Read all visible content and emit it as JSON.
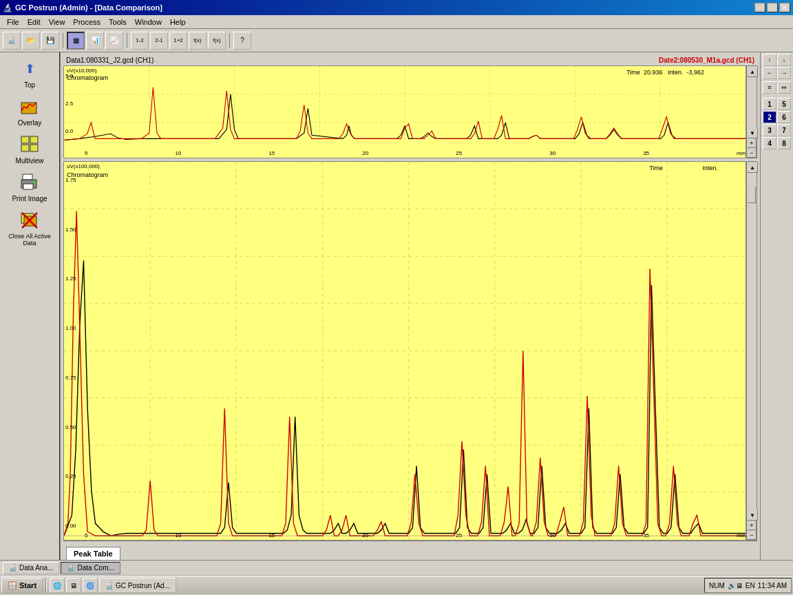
{
  "window": {
    "title": "GC Postrun (Admin) - [Data Comparison]",
    "app_icon": "🔬"
  },
  "title_controls": {
    "minimize": "─",
    "maximize": "□",
    "close": "✕",
    "inner_minimize": "─",
    "inner_maximize": "□",
    "inner_close": "✕"
  },
  "menu": {
    "items": [
      "File",
      "Edit",
      "View",
      "Process",
      "Tools",
      "Window",
      "Help"
    ]
  },
  "sidebar": {
    "items": [
      {
        "id": "top",
        "label": "Top",
        "icon": "⬆"
      },
      {
        "id": "overlay",
        "label": "Overlay",
        "icon": "📊"
      },
      {
        "id": "multiview",
        "label": "Multiview",
        "icon": "📈"
      },
      {
        "id": "print-image",
        "label": "Print Image",
        "icon": "🖨"
      },
      {
        "id": "close-all-active",
        "label": "Close All Active Data",
        "icon": "❌"
      }
    ]
  },
  "charts": {
    "data1_label": "Data1:080331_J2.gcd (CH1)",
    "data2_label": "Date2:080530_M1a.gcd (CH1)",
    "time_label": "Time",
    "inten_label": "Inten.",
    "time_value": "20.936",
    "inten_value": "-3,962",
    "top_chart": {
      "y_unit": "uV(x10,000)",
      "y_max": "5.0",
      "y_mid": "2.5",
      "y_min": "0.0",
      "label": "Chromatogram",
      "x_ticks": [
        "5",
        "10",
        "15",
        "20",
        "25",
        "30",
        "35"
      ],
      "x_unit": "min"
    },
    "main_chart": {
      "y_unit": "uV(x100,000)",
      "y_ticks": [
        "1.75",
        "1.50",
        "1.25",
        "1.00",
        "0.75",
        "0.50",
        "0.25",
        "0.00"
      ],
      "label": "Chromatogram",
      "x_ticks": [
        "5",
        "10",
        "15",
        "20",
        "25",
        "30",
        "35"
      ],
      "x_unit": "min"
    }
  },
  "right_panel": {
    "nav_buttons": [
      "↑",
      "↓",
      "←"
    ],
    "sep": "≡",
    "numbers": [
      {
        "val": "1",
        "active": false
      },
      {
        "val": "5",
        "active": false
      },
      {
        "val": "2",
        "active": true
      },
      {
        "val": "6",
        "active": false
      },
      {
        "val": "3",
        "active": false
      },
      {
        "val": "7",
        "active": false
      },
      {
        "val": "4",
        "active": false
      },
      {
        "val": "8",
        "active": false
      }
    ]
  },
  "tabs": {
    "bottom": [
      {
        "id": "peak-table",
        "label": "Peak Table",
        "active": true
      }
    ]
  },
  "taskbar_tabs": [
    {
      "id": "data-analysis",
      "label": "Data Ana...",
      "icon": "🔬",
      "active": false
    },
    {
      "id": "data-comparison",
      "label": "Data Com...",
      "icon": "🔬",
      "active": true
    }
  ],
  "taskbar": {
    "start_label": "Start",
    "apps": [
      {
        "id": "gcpostrun",
        "label": "GC Postrun (Ad...",
        "icon": "🔬"
      }
    ],
    "time": "11:34 AM",
    "language": "EN",
    "num_lock": "NUM"
  }
}
